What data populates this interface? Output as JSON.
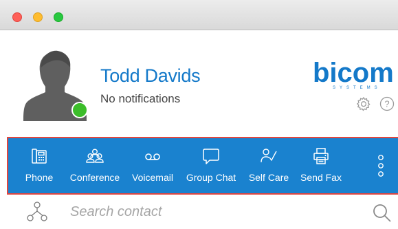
{
  "window": {
    "controls": [
      "close",
      "minimize",
      "maximize"
    ]
  },
  "profile": {
    "name": "Todd Davids",
    "notifications": "No notifications",
    "presence_color": "#3cbd2a",
    "avatar_icon": "user-silhouette-icon"
  },
  "brand": {
    "logo": "bicom",
    "logo_sub": "SYSTEMS",
    "color": "#1479c9",
    "icons": [
      "gear-icon",
      "help-icon"
    ]
  },
  "toolbar": {
    "background": "#1a82cf",
    "items": [
      {
        "label": "Phone",
        "icon": "phone-icon"
      },
      {
        "label": "Conference",
        "icon": "conference-icon"
      },
      {
        "label": "Voicemail",
        "icon": "voicemail-icon"
      },
      {
        "label": "Group Chat",
        "icon": "chat-bubble-icon"
      },
      {
        "label": "Self Care",
        "icon": "self-care-icon"
      },
      {
        "label": "Send Fax",
        "icon": "fax-icon"
      }
    ],
    "more_icon": "more-vertical-icon"
  },
  "search": {
    "placeholder": "Search contact",
    "value": "",
    "left_icon": "org-chart-icon",
    "right_icon": "search-icon"
  }
}
